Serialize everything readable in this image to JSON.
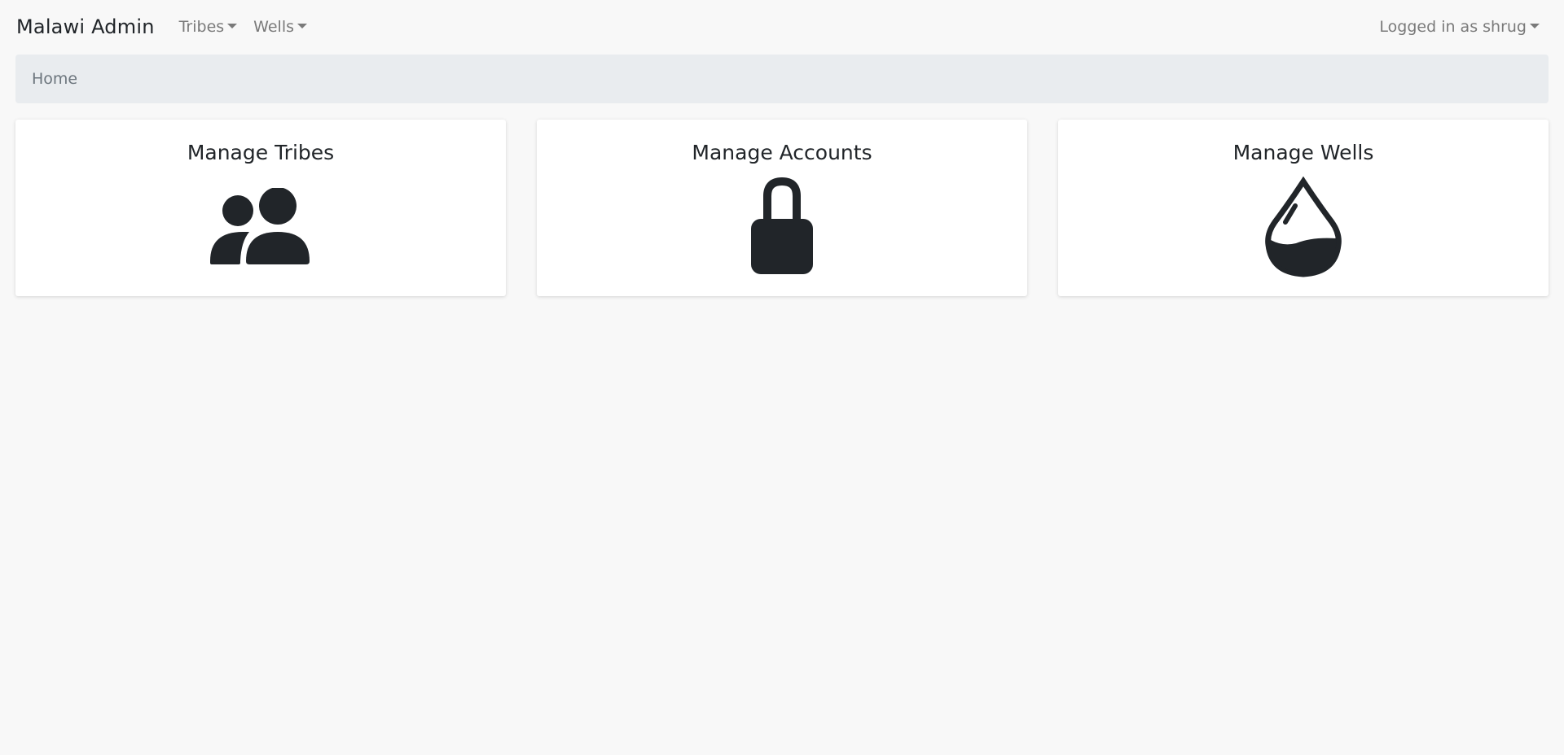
{
  "navbar": {
    "brand": "Malawi Admin",
    "menus": [
      {
        "label": "Tribes"
      },
      {
        "label": "Wells"
      }
    ],
    "user_menu": "Logged in as shrug"
  },
  "breadcrumb": {
    "current": "Home"
  },
  "cards": [
    {
      "title": "Manage Tribes",
      "icon": "users-icon"
    },
    {
      "title": "Manage Accounts",
      "icon": "lock-icon"
    },
    {
      "title": "Manage Wells",
      "icon": "water-drop-icon"
    }
  ],
  "colors": {
    "background": "#f8f8f8",
    "breadcrumb_bg": "#e9ecef",
    "icon": "#212529",
    "nav_text": "#7a7a7a"
  }
}
